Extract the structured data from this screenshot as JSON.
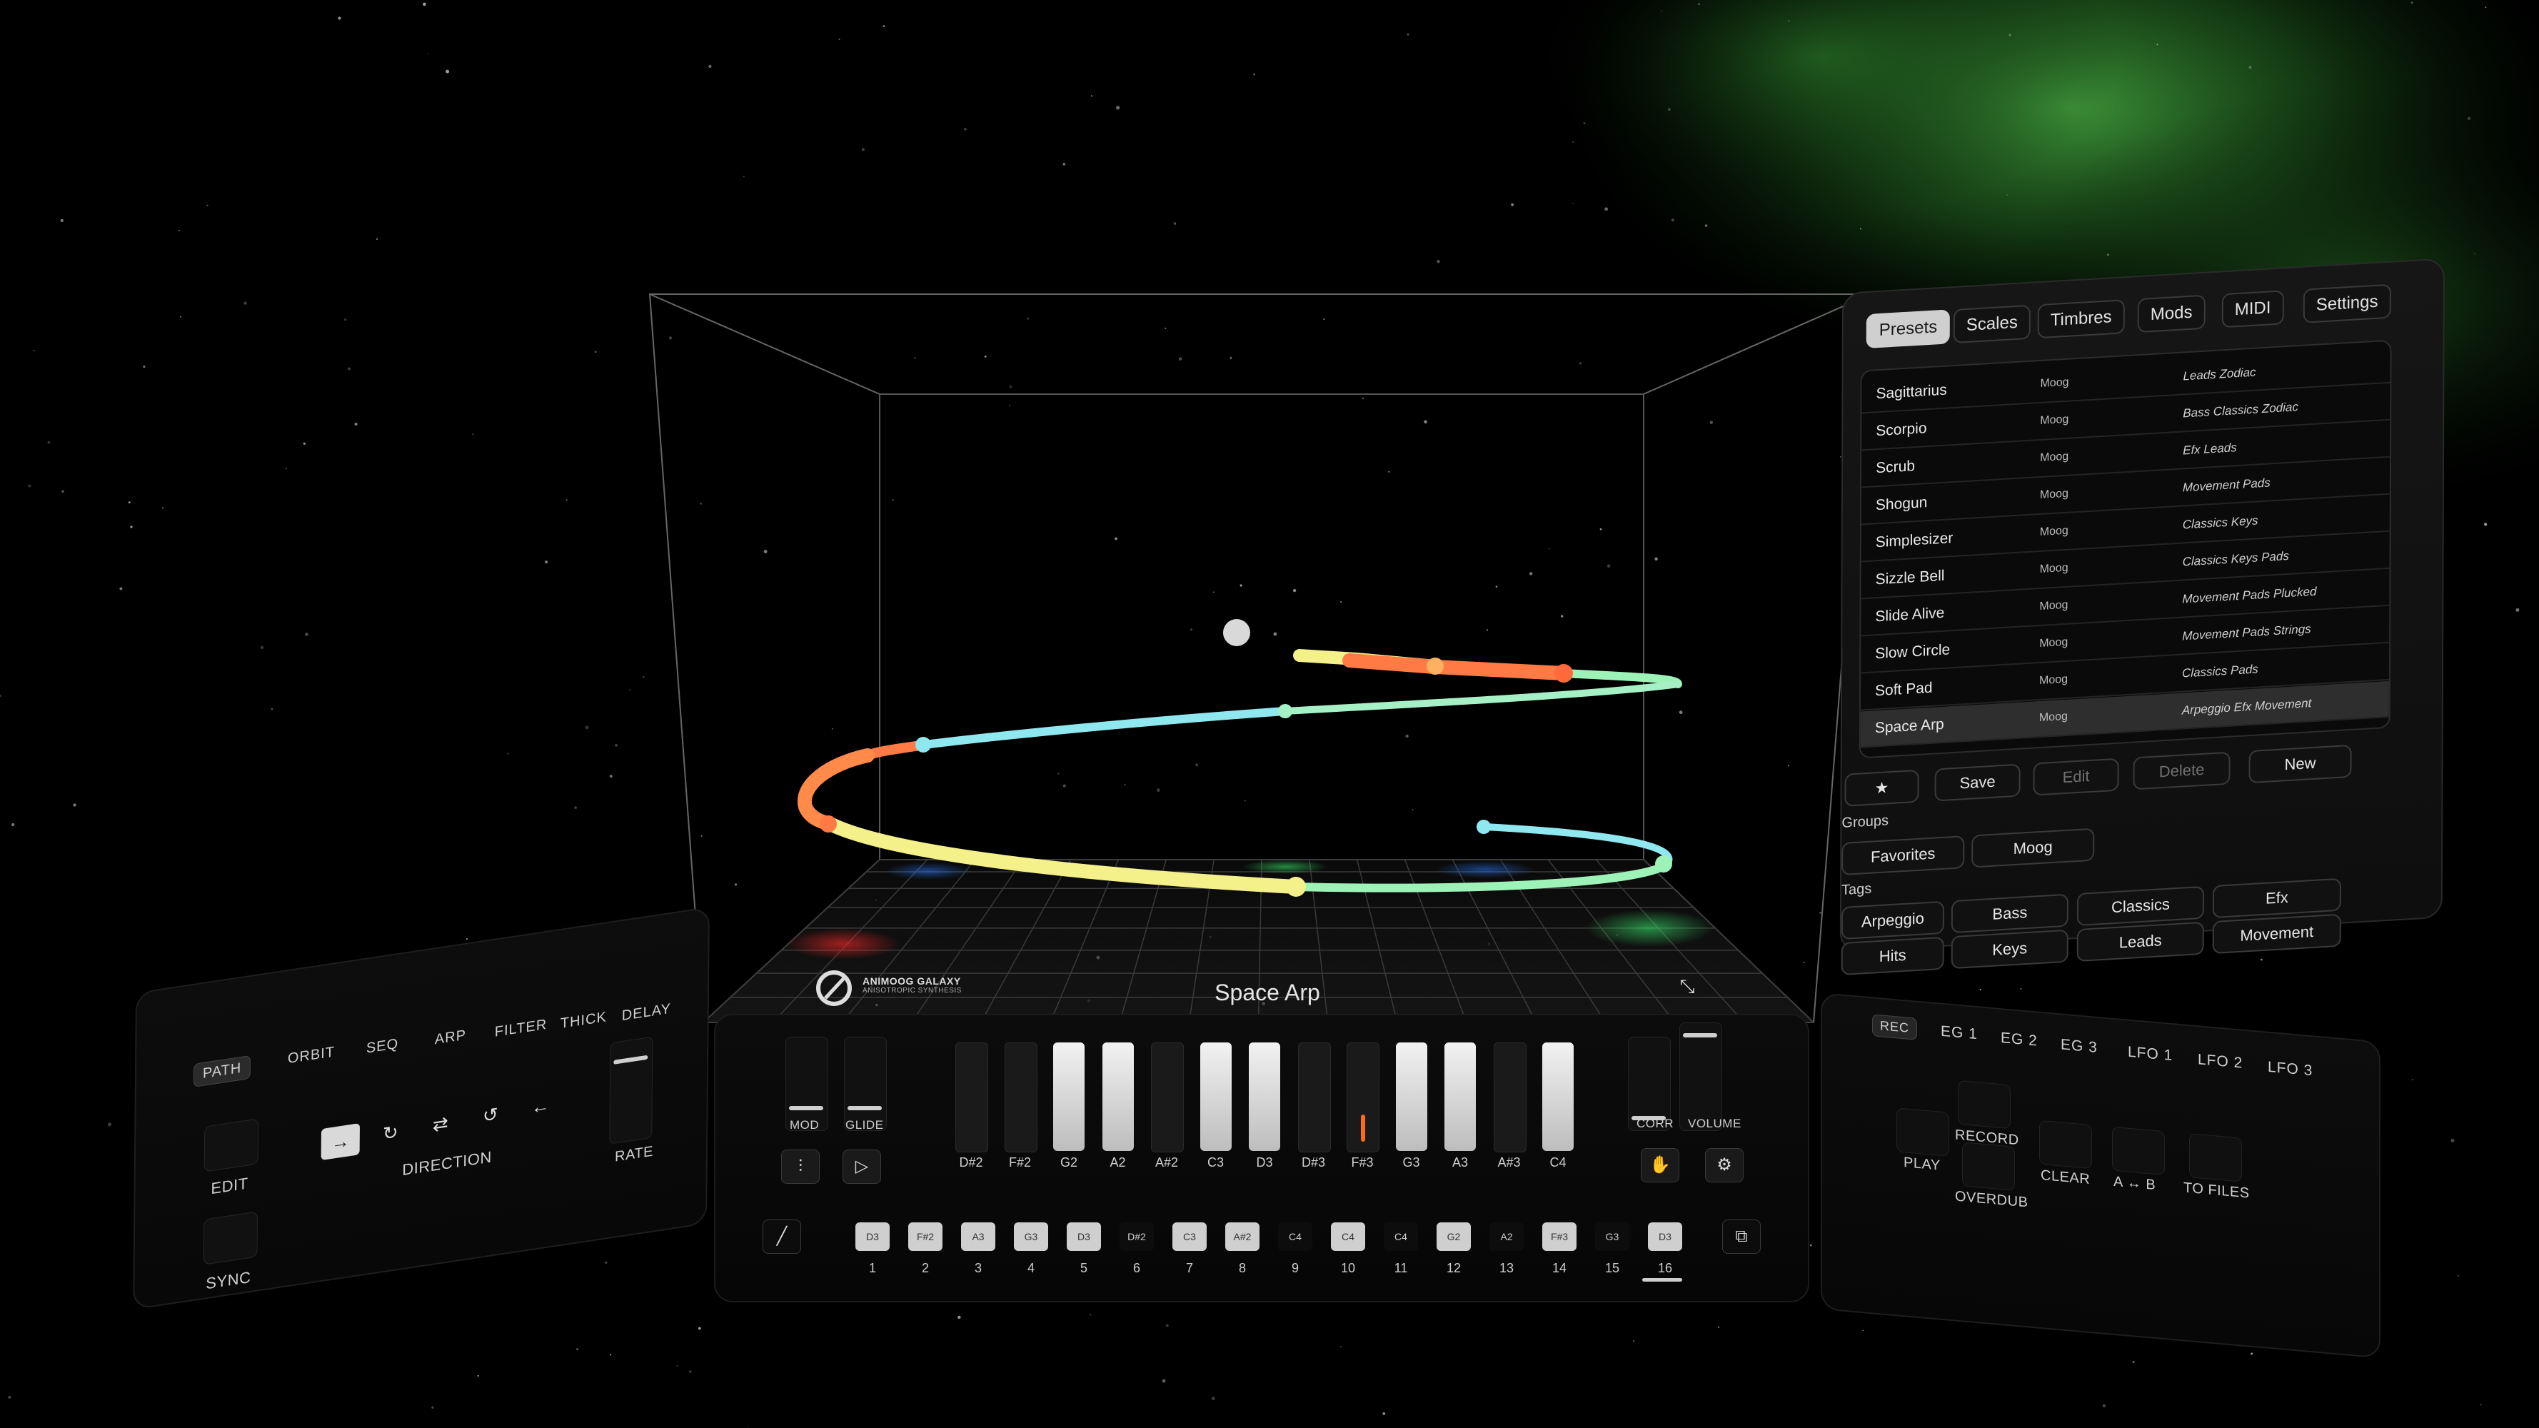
{
  "app": {
    "logo_title": "ANIMOOG GALAXY",
    "logo_subtitle": "ANISOTROPIC SYNTHESIS",
    "current_preset": "Space Arp",
    "collapse_icon": "collapse-arrows-icon"
  },
  "left_panel": {
    "tabs": [
      "PATH",
      "ORBIT",
      "SEQ",
      "ARP",
      "FILTER",
      "THICK",
      "DELAY"
    ],
    "active_tab": "PATH",
    "edit_label": "EDIT",
    "sync_label": "SYNC",
    "direction_label": "DIRECTION",
    "rate_label": "RATE",
    "direction_icons": [
      "arrow-right-icon",
      "loop-forward-icon",
      "loop-double-icon",
      "loop-back-icon",
      "arrow-left-icon"
    ]
  },
  "presets_panel": {
    "tabs": [
      "Presets",
      "Scales",
      "Timbres",
      "Mods",
      "MIDI",
      "Settings"
    ],
    "active_tab": "Presets",
    "rows": [
      {
        "name": "Sagittarius",
        "maker": "Moog",
        "tags": "Leads Zodiac"
      },
      {
        "name": "Scorpio",
        "maker": "Moog",
        "tags": "Bass Classics Zodiac"
      },
      {
        "name": "Scrub",
        "maker": "Moog",
        "tags": "Efx Leads"
      },
      {
        "name": "Shogun",
        "maker": "Moog",
        "tags": "Movement Pads"
      },
      {
        "name": "Simplesizer",
        "maker": "Moog",
        "tags": "Classics Keys"
      },
      {
        "name": "Sizzle Bell",
        "maker": "Moog",
        "tags": "Classics Keys Pads"
      },
      {
        "name": "Slide Alive",
        "maker": "Moog",
        "tags": "Movement Pads Plucked"
      },
      {
        "name": "Slow Circle",
        "maker": "Moog",
        "tags": "Movement Pads Strings"
      },
      {
        "name": "Soft Pad",
        "maker": "Moog",
        "tags": "Classics Pads"
      },
      {
        "name": "Space Arp",
        "maker": "Moog",
        "tags": "Arpeggio Efx Movement"
      }
    ],
    "selected_row": 9,
    "actions": {
      "favorite": "★",
      "save": "Save",
      "edit": "Edit",
      "delete": "Delete",
      "new": "New"
    },
    "groups_label": "Groups",
    "groups": [
      "Favorites",
      "Moog"
    ],
    "tags_label": "Tags",
    "tags": [
      "Arpeggio",
      "Bass",
      "Classics",
      "Efx",
      "Hits",
      "Keys",
      "Leads",
      "Movement"
    ]
  },
  "recorder_panel": {
    "rec_label": "REC",
    "tabs": [
      "EG 1",
      "EG 2",
      "EG 3",
      "LFO 1",
      "LFO 2",
      "LFO 3"
    ],
    "buttons": {
      "play": "PLAY",
      "record": "RECORD",
      "overdub": "OVERDUB",
      "clear": "CLEAR",
      "ab": "A ↔ B",
      "to_files": "TO FILES"
    }
  },
  "keyboard": {
    "mod_label": "MOD",
    "glide_label": "GLIDE",
    "corr_label": "CORR",
    "volume_label": "VOLUME",
    "keys": [
      {
        "note": "D#2",
        "color": "black"
      },
      {
        "note": "F#2",
        "color": "black"
      },
      {
        "note": "G2",
        "color": "white"
      },
      {
        "note": "A2",
        "color": "white"
      },
      {
        "note": "A#2",
        "color": "black"
      },
      {
        "note": "C3",
        "color": "white"
      },
      {
        "note": "D3",
        "color": "white"
      },
      {
        "note": "D#3",
        "color": "black"
      },
      {
        "note": "F#3",
        "color": "black"
      },
      {
        "note": "G3",
        "color": "white"
      },
      {
        "note": "A3",
        "color": "white"
      },
      {
        "note": "A#3",
        "color": "black"
      },
      {
        "note": "C4",
        "color": "white"
      }
    ],
    "active_key": "F#3",
    "active_color": "#ff6a1a",
    "steps": [
      {
        "note": "D3",
        "on": true
      },
      {
        "note": "F#2",
        "on": true
      },
      {
        "note": "A3",
        "on": true
      },
      {
        "note": "G3",
        "on": true
      },
      {
        "note": "D3",
        "on": true
      },
      {
        "note": "D#2",
        "on": false
      },
      {
        "note": "C3",
        "on": true
      },
      {
        "note": "A#2",
        "on": true
      },
      {
        "note": "C4",
        "on": false
      },
      {
        "note": "C4",
        "on": true
      },
      {
        "note": "C4",
        "on": false
      },
      {
        "note": "G2",
        "on": true
      },
      {
        "note": "A2",
        "on": false
      },
      {
        "note": "F#3",
        "on": true
      },
      {
        "note": "G3",
        "on": false
      },
      {
        "note": "D3",
        "on": true
      }
    ],
    "step_numbers": [
      "1",
      "2",
      "3",
      "4",
      "5",
      "6",
      "7",
      "8",
      "9",
      "10",
      "11",
      "12",
      "13",
      "14",
      "15",
      "16"
    ],
    "icons": [
      "mixer-sliders-icon",
      "play-icon",
      "hand-icon",
      "gear-icon",
      "pencil-icon",
      "copy-icon"
    ]
  },
  "colors": {
    "trail_orange": "#ff7a45",
    "trail_yellow": "#f4f08a",
    "trail_cyan": "#8fe8f0",
    "trail_mint": "#9df2b8",
    "nebula_green": "#3faa3a"
  }
}
